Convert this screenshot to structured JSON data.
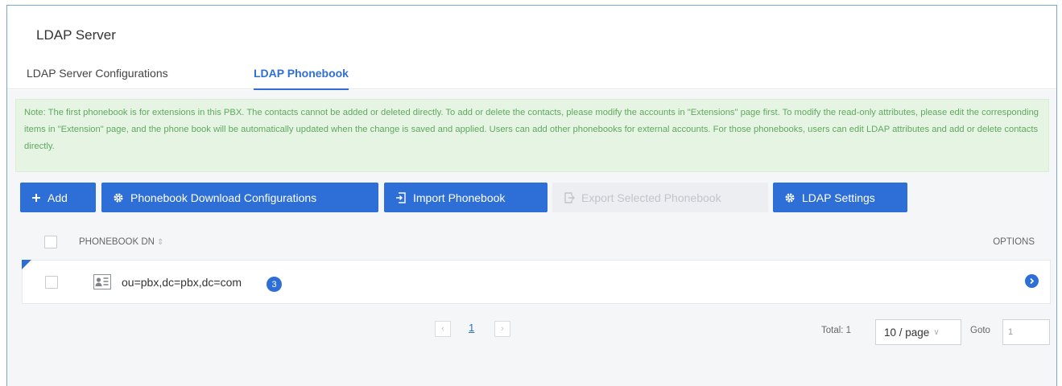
{
  "panel": {
    "title": "LDAP Server"
  },
  "tabs": [
    {
      "label": "LDAP Server Configurations"
    },
    {
      "label": "LDAP Phonebook"
    }
  ],
  "note": "Note: The first phonebook is for extensions in this PBX. The contacts cannot be added or deleted directly. To add or delete the contacts, please modify the accounts in \"Extensions\" page first. To modify the read-only attributes, please edit the corresponding items in \"Extension\" page, and the phone book will be automatically updated when the change is saved and applied. Users can add other phonebooks for external accounts. For those phonebooks, users can edit LDAP attributes and add or delete contacts directly.",
  "toolbar": {
    "add": "Add",
    "phonebook_download": "Phonebook Download Configurations",
    "import": "Import Phonebook",
    "export": "Export Selected Phonebook",
    "ldap_settings": "LDAP Settings"
  },
  "table": {
    "col_dn": "PHONEBOOK DN",
    "col_options": "OPTIONS",
    "rows": [
      {
        "dn": "ou=pbx,dc=pbx,dc=com",
        "count": "3"
      }
    ]
  },
  "pagination": {
    "current": "1",
    "total": "Total: 1",
    "page_size": "10 / page",
    "goto_label": "Goto",
    "goto_value": "1"
  },
  "colors": {
    "primary": "#2d6fd6",
    "note_bg": "#e6f5e3",
    "note_text": "#5fa85f"
  },
  "icons": {
    "add": "plus-icon",
    "download_config": "gear-icon",
    "import": "import-icon",
    "export": "export-icon",
    "settings": "gear-icon",
    "contact": "contact-card-icon",
    "options": "chevron-right-circle-icon"
  }
}
